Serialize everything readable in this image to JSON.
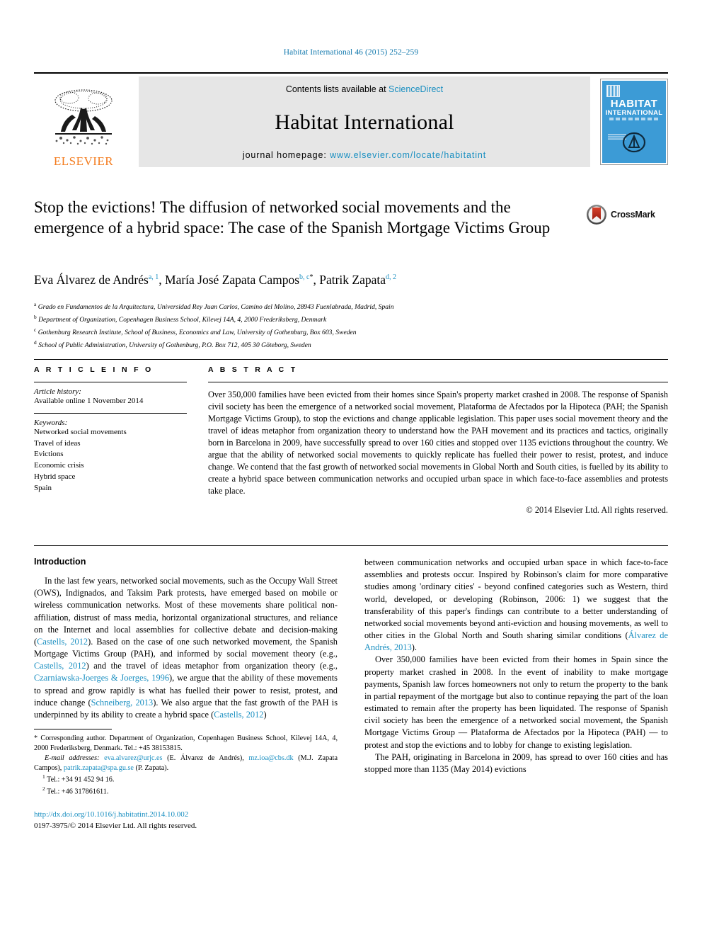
{
  "running_head": "Habitat International 46 (2015) 252–259",
  "masthead": {
    "publisher_logo_text": "ELSEVIER",
    "contents_prefix": "Contents lists available at ",
    "contents_link": "ScienceDirect",
    "journal_name": "Habitat International",
    "homepage_prefix": "journal homepage: ",
    "homepage_url": "www.elsevier.com/locate/habitatint",
    "cover_title_line1": "HABITAT",
    "cover_title_line2": "INTERNATIONAL"
  },
  "article": {
    "title": "Stop the evictions! The diffusion of networked social movements and the emergence of a hybrid space: The case of the Spanish Mortgage Victims Group",
    "crossmark_label": "CrossMark",
    "authors": [
      {
        "name": "Eva Álvarez de Andrés",
        "marks": "a, 1"
      },
      {
        "name": "María José Zapata Campos",
        "marks": "b, c"
      },
      {
        "name": "Patrik Zapata",
        "marks": "d, 2"
      }
    ],
    "affiliations": [
      {
        "mark": "a",
        "text": "Grado en Fundamentos de la Arquitectura, Universidad Rey Juan Carlos, Camino del Molino, 28943 Fuenlabrada, Madrid, Spain"
      },
      {
        "mark": "b",
        "text": "Department of Organization, Copenhagen Business School, Kilevej 14A, 4, 2000 Frederiksberg, Denmark"
      },
      {
        "mark": "c",
        "text": "Gothenburg Research Institute, School of Business, Economics and Law, University of Gothenburg, Box 603, Sweden"
      },
      {
        "mark": "d",
        "text": "School of Public Administration, University of Gothenburg, P.O. Box 712, 405 30 Göteborg, Sweden"
      }
    ]
  },
  "info": {
    "heading": "A R T I C L E   I N F O",
    "history_label": "Article history:",
    "history_value": "Available online 1 November 2014",
    "keywords_label": "Keywords:",
    "keywords": [
      "Networked social movements",
      "Travel of ideas",
      "Evictions",
      "Economic crisis",
      "Hybrid space",
      "Spain"
    ]
  },
  "abstract": {
    "heading": "A B S T R A C T",
    "text": "Over 350,000 families have been evicted from their homes since Spain's property market crashed in 2008. The response of Spanish civil society has been the emergence of a networked social movement, Plataforma de Afectados por la Hipoteca (PAH; the Spanish Mortgage Victims Group), to stop the evictions and change applicable legislation. This paper uses social movement theory and the travel of ideas metaphor from organization theory to understand how the PAH movement and its practices and tactics, originally born in Barcelona in 2009, have successfully spread to over 160 cities and stopped over 1135 evictions throughout the country. We argue that the ability of networked social movements to quickly replicate has fuelled their power to resist, protest, and induce change. We contend that the fast growth of networked social movements in Global North and South cities, is fuelled by its ability to create a hybrid space between communication networks and occupied urban space in which face-to-face assemblies and protests take place.",
    "copyright": "© 2014 Elsevier Ltd. All rights reserved."
  },
  "body": {
    "section_heading": "Introduction",
    "left_para_1_a": "In the last few years, networked social movements, such as the Occupy Wall Street (OWS), Indignados, and Taksim Park protests, have emerged based on mobile or wireless communication networks. Most of these movements share political non-affiliation, distrust of mass media, horizontal organizational structures, and reliance on the Internet and local assemblies for collective debate and decision-making (",
    "ref_castells_2012_a": "Castells, 2012",
    "left_para_1_b": "). Based on the case of one such networked movement, the Spanish Mortgage Victims Group (PAH), and informed by social movement theory (e.g., ",
    "ref_castells_2012_b": "Castells, 2012",
    "left_para_1_c": ") and the travel of ideas metaphor from organization theory (e.g., ",
    "ref_czarniawska": "Czarniawska-Joerges & Joerges, 1996",
    "left_para_1_d": "), we argue that the ability of these movements to spread and grow rapidly is what has fuelled their power to resist, protest, and induce change (",
    "ref_schneiberg": "Schneiberg, 2013",
    "left_para_1_e": "). We also argue that the fast growth of the PAH is underpinned by its ability to create a hybrid space (",
    "ref_castells_2012_c": "Castells, 2012",
    "left_para_1_f": ")",
    "right_para_1_a": "between communication networks and occupied urban space in which face-to-face assemblies and protests occur. Inspired by Robinson's claim for more comparative studies among 'ordinary cities' - beyond confined categories such as Western, third world, developed, or developing (Robinson, 2006: 1) we suggest that the transferability of this paper's findings can contribute to a better understanding of networked social movements beyond anti-eviction and housing movements, as well to other cities in the Global North and South sharing similar conditions (",
    "ref_alvarez": "Álvarez de Andrés, 2013",
    "right_para_1_b": ").",
    "right_para_2": "Over 350,000 families have been evicted from their homes in Spain since the property market crashed in 2008. In the event of inability to make mortgage payments, Spanish law forces homeowners not only to return the property to the bank in partial repayment of the mortgage but also to continue repaying the part of the loan estimated to remain after the property has been liquidated. The response of Spanish civil society has been the emergence of a networked social movement, the Spanish Mortgage Victims Group — Plataforma de Afectados por la Hipoteca (PAH) — to protest and stop the evictions and to lobby for change to existing legislation.",
    "right_para_3": "The PAH, originating in Barcelona in 2009, has spread to over 160 cities and has stopped more than 1135 (May 2014) evictions"
  },
  "footnotes": {
    "corresponding": "* Corresponding author. Department of Organization, Copenhagen Business School, Kilevej 14A, 4, 2000 Frederiksberg, Denmark. Tel.: +45 38153815.",
    "email_label": "E-mail addresses:",
    "email_1": "eva.alvarez@urjc.es",
    "email_1_owner": "(E. Álvarez de Andrés),",
    "email_2": "mz.ioa@cbs.dk",
    "email_2_owner": "(M.J. Zapata Campos),",
    "email_3": "patrik.zapata@spa.gu.se",
    "email_3_owner": "(P. Zapata).",
    "tel_1_mark": "1",
    "tel_1": "Tel.: +34 91 452 94 16.",
    "tel_2_mark": "2",
    "tel_2": "Tel.: +46 317861611.",
    "doi": "http://dx.doi.org/10.1016/j.habitatint.2014.10.002",
    "issn_line": "0197-3975/© 2014 Elsevier Ltd. All rights reserved."
  },
  "colors": {
    "link": "#1a8fc1",
    "running_head": "#1178ad",
    "elsevier_orange": "#f47d20",
    "cover_blue": "#3c9bd6",
    "band_gray": "#e6e6e6"
  }
}
